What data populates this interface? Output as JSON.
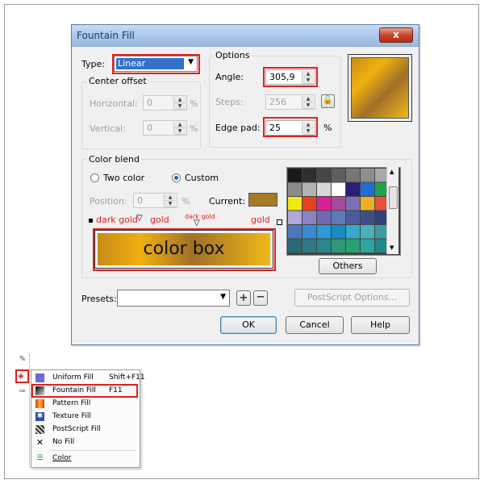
{
  "dialog": {
    "title": "Fountain Fill",
    "close_glyph": "x",
    "type_label": "Type:",
    "type_value": "Linear",
    "center_offset": {
      "title": "Center offset",
      "horizontal_label": "Horizontal:",
      "horizontal_value": "0",
      "vertical_label": "Vertical:",
      "vertical_value": "0",
      "unit": "%"
    },
    "options": {
      "title": "Options",
      "angle_label": "Angle:",
      "angle_value": "305,9",
      "steps_label": "Steps:",
      "steps_value": "256",
      "edge_pad_label": "Edge pad:",
      "edge_pad_value": "25",
      "unit": "%"
    },
    "color_blend": {
      "title": "Color blend",
      "two_color_label": "Two color",
      "custom_label": "Custom",
      "selected_mode": "Custom",
      "position_label": "Position:",
      "position_value": "0",
      "unit": "%",
      "current_label": "Current:",
      "current_color": "#a67a25",
      "others_label": "Others",
      "palette": [
        [
          "#1a1a1a",
          "#2e2e2e",
          "#464646",
          "#5e5e5e",
          "#777777",
          "#8f8f8f",
          "#a8a8a8"
        ],
        [
          "#8a8a8a",
          "#b3b3b3",
          "#d8d8d8",
          "#ffffff",
          "#2a1f78",
          "#1f6fd1",
          "#20a050"
        ],
        [
          "#f0ea10",
          "#e8401e",
          "#d8209a",
          "#a84a9a",
          "#7c6fb8",
          "#f0b020",
          "#e8503c"
        ],
        [
          "#b0a8d8",
          "#8c82c0",
          "#6f6ab0",
          "#5e7ab8",
          "#4c5aa0",
          "#3e4e88",
          "#30407a"
        ],
        [
          "#4c78b8",
          "#3a8ad0",
          "#2a9ad8",
          "#1a8ac0",
          "#38a8c8",
          "#4ab0b8",
          "#3c9aa0"
        ],
        [
          "#2a6878",
          "#307a88",
          "#28888a",
          "#309878",
          "#28a070",
          "#2aa8a0",
          "#1e8a88"
        ]
      ]
    },
    "annotations": {
      "left_1": "dark gold",
      "left_2": "gold",
      "mid": "dark gold",
      "right": "gold",
      "color_box": "color box"
    },
    "presets_label": "Presets:",
    "presets_value": "",
    "postscript_label": "PostScript Options...",
    "ok_label": "OK",
    "cancel_label": "Cancel",
    "help_label": "Help",
    "gradient_colors": [
      "#c88a18",
      "#f0b010",
      "#a07028",
      "#f0b818"
    ]
  },
  "menu": {
    "items": [
      {
        "icon": "uniform-fill-icon",
        "label": "Uniform Fill",
        "shortcut": "Shift+F11"
      },
      {
        "icon": "fountain-fill-icon",
        "label": "Fountain Fill",
        "shortcut": "F11"
      },
      {
        "icon": "pattern-fill-icon",
        "label": "Pattern Fill",
        "shortcut": ""
      },
      {
        "icon": "texture-fill-icon",
        "label": "Texture Fill",
        "shortcut": ""
      },
      {
        "icon": "postscript-fill-icon",
        "label": "PostScript Fill",
        "shortcut": ""
      },
      {
        "icon": "no-fill-icon",
        "label": "No Fill",
        "shortcut": ""
      },
      {
        "icon": "color-icon",
        "label": "Color",
        "shortcut": ""
      }
    ],
    "selected": "Fountain Fill"
  }
}
